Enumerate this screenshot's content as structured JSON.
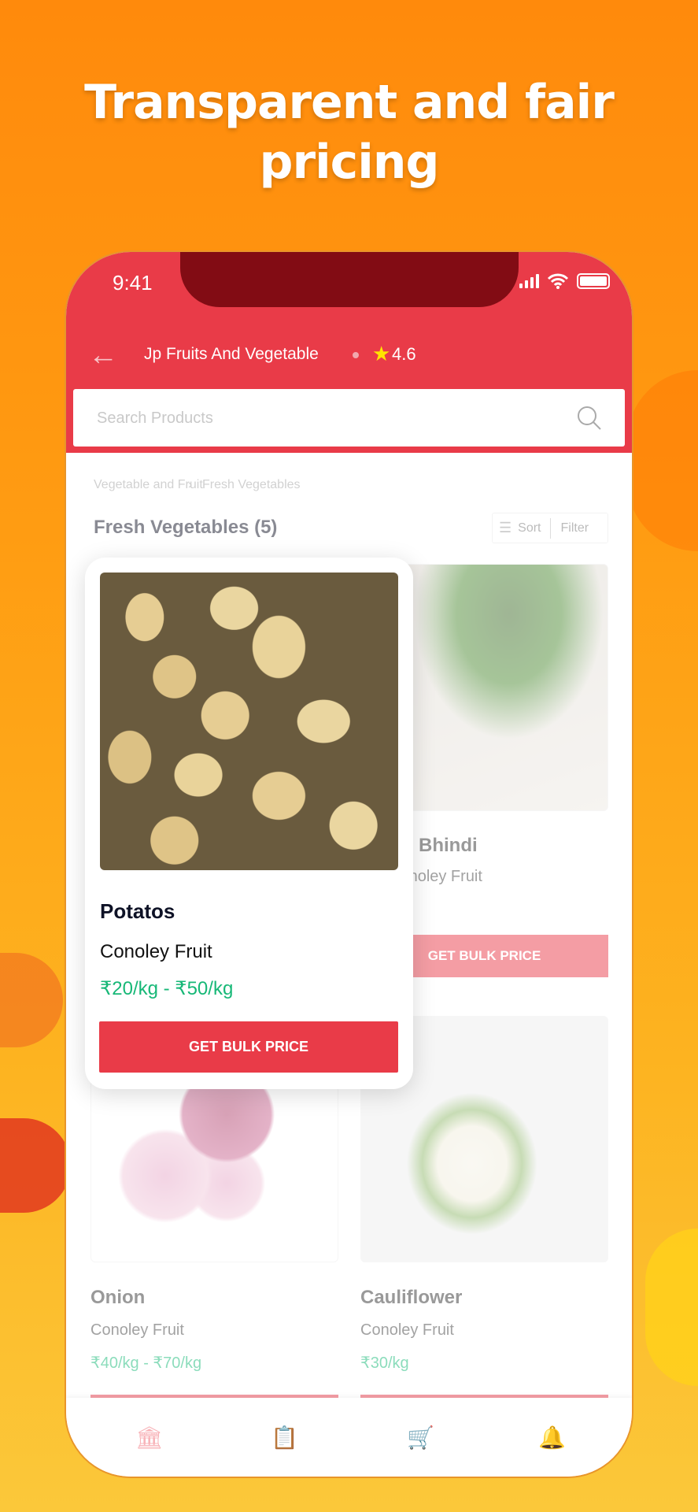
{
  "headline": {
    "line1": "Transparent and fair",
    "line2": "pricing"
  },
  "status": {
    "time": "9:41"
  },
  "header": {
    "shop_name": "Jp Fruits And Vegetable",
    "rating": "4.6",
    "back_icon": "arrow-left-icon",
    "star_icon": "star-icon"
  },
  "search": {
    "placeholder": "Search Products",
    "icon": "search-icon"
  },
  "breadcrumb": {
    "items": [
      "Vegetable and Fruit",
      "Fresh Vegetables"
    ]
  },
  "section": {
    "title": "Fresh Vegetables (5)",
    "sort_label": "Sort",
    "filter_label": "Filter"
  },
  "products": [
    {
      "name": "Bhindi",
      "seller": "Conoley Fruit",
      "button": "GET BULK PRICE"
    },
    {
      "name": "Onion",
      "seller": "Conoley Fruit",
      "price": "₹40/kg - ₹70/kg"
    },
    {
      "name": "Cauliflower",
      "seller": "Conoley Fruit",
      "price": "₹30/kg"
    }
  ],
  "popup": {
    "name": "Potatos",
    "seller": "Conoley Fruit",
    "price": "₹20/kg - ₹50/kg",
    "button": "GET BULK PRICE"
  },
  "nav": {
    "items": [
      {
        "icon": "store-icon"
      },
      {
        "icon": "clipboard-icon"
      },
      {
        "icon": "cart-icon"
      },
      {
        "icon": "bell-icon"
      }
    ]
  },
  "colors": {
    "brand": "#e93b48",
    "price": "#17b877",
    "background": "#ff9c12"
  }
}
